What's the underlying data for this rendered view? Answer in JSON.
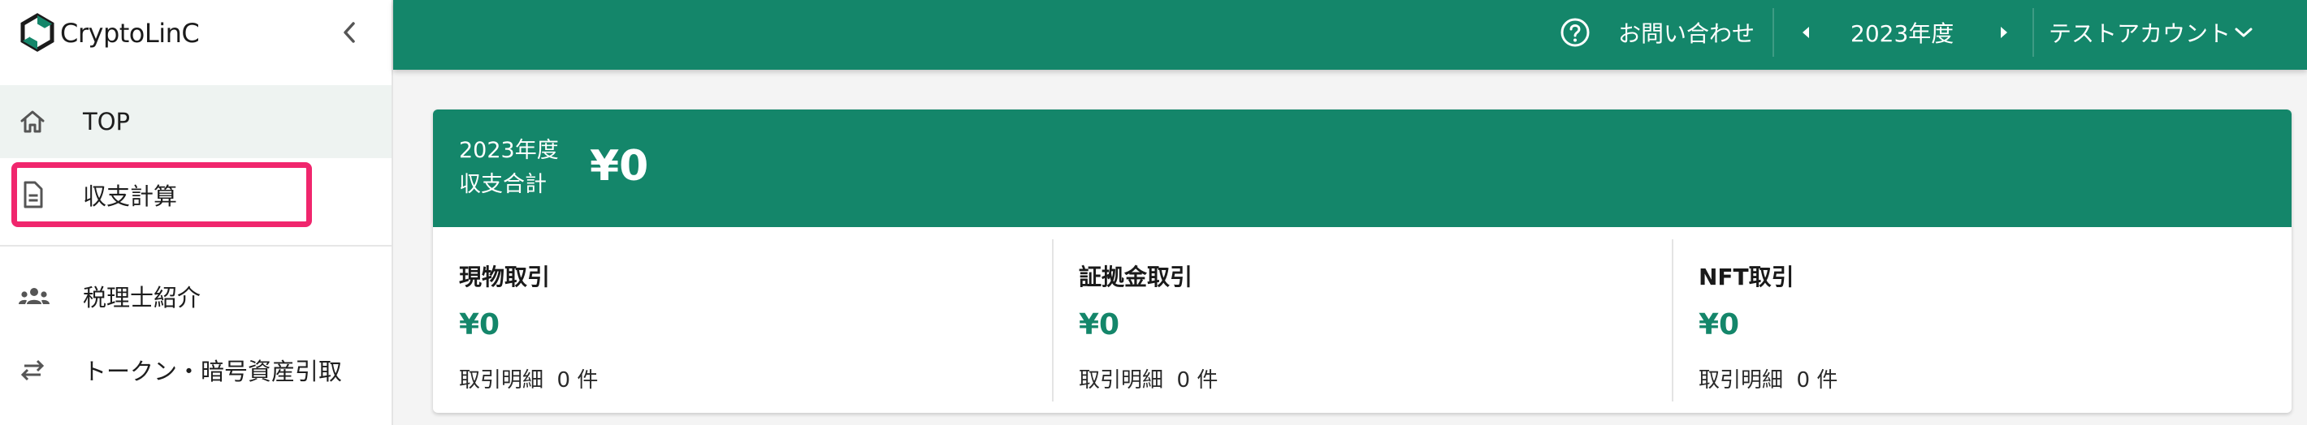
{
  "sidebar": {
    "brand": "CryptoLinC",
    "items": [
      {
        "label": "TOP",
        "icon": "home-icon"
      },
      {
        "label": "収支計算",
        "icon": "document-icon"
      },
      {
        "label": "税理士紹介",
        "icon": "people-icon"
      },
      {
        "label": "トークン・暗号資産引取",
        "icon": "swap-arrows-icon"
      }
    ]
  },
  "header": {
    "help_icon": "help-circle-icon",
    "contact": "お問い合わせ",
    "year": "2023年度",
    "account": "テストアカウント"
  },
  "summary": {
    "year_label": "2023年度",
    "sub_label": "収支合計",
    "total": "¥0",
    "columns": [
      {
        "title": "現物取引",
        "amount": "¥0",
        "detail_label": "取引明細",
        "count": "0",
        "unit": "件"
      },
      {
        "title": "証拠金取引",
        "amount": "¥0",
        "detail_label": "取引明細",
        "count": "0",
        "unit": "件"
      },
      {
        "title": "NFT取引",
        "amount": "¥0",
        "detail_label": "取引明細",
        "count": "0",
        "unit": "件"
      }
    ]
  },
  "colors": {
    "primary": "#14866a",
    "highlight": "#f0266d",
    "active_bg": "#eef3f1"
  }
}
